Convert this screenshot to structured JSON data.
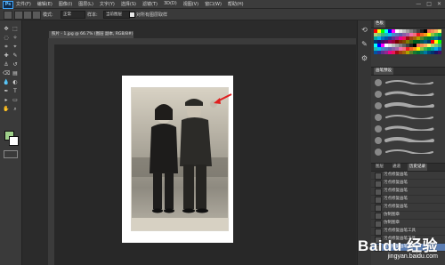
{
  "app": {
    "logo_text": "Ps"
  },
  "menubar": {
    "items": [
      "文件(F)",
      "编辑(E)",
      "图像(I)",
      "图层(L)",
      "文字(Y)",
      "选择(S)",
      "滤镜(T)",
      "3D(D)",
      "视图(V)",
      "窗口(W)",
      "帮助(H)"
    ],
    "controls": [
      "—",
      "□",
      "✕"
    ]
  },
  "options": {
    "mode_label": "模式:",
    "mode_value": "正常",
    "sample_label": "样本:",
    "sample_value": "当前图层",
    "align_label": "对所有图层取样"
  },
  "document": {
    "tab_title": "照片 - 1.jpg @ 66.7% (图层 副本, RGB/8#) *"
  },
  "tools": [
    "move-icon",
    "marquee-icon",
    "lasso-icon",
    "quick-select-icon",
    "crop-icon",
    "eyedropper-icon",
    "healing-icon",
    "brush-icon",
    "clone-stamp-icon",
    "history-brush-icon",
    "eraser-icon",
    "gradient-icon",
    "blur-icon",
    "dodge-icon",
    "pen-icon",
    "type-icon",
    "path-select-icon",
    "shape-icon",
    "hand-icon",
    "zoom-icon"
  ],
  "colors": {
    "foreground": "#9fd08a",
    "background": "#ffffff",
    "accent": "#5a7db3",
    "arrow": "#e02020"
  },
  "panels": {
    "swatches_tab": "色板",
    "brush_tab": "画笔预设",
    "history_tabs": [
      "图层",
      "通道",
      "历史记录"
    ],
    "history_items": [
      "污点修复画笔",
      "污点修复画笔",
      "污点修复画笔",
      "污点修复画笔",
      "污点修复画笔",
      "仿制图章",
      "仿制图章",
      "污点修复画笔工具",
      "污点修复画笔工具",
      "污点修复画笔工具"
    ]
  },
  "watermark": {
    "brand": "Baidu 经验",
    "url": "jingyan.baidu.com"
  }
}
